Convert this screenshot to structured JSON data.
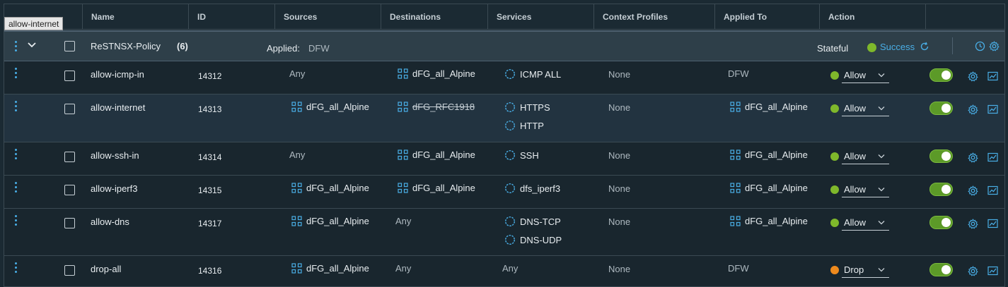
{
  "tooltip": "allow-internet",
  "columns": {
    "name": "Name",
    "id": "ID",
    "sources": "Sources",
    "destinations": "Destinations",
    "services": "Services",
    "context_profiles": "Context Profiles",
    "applied_to": "Applied To",
    "action": "Action"
  },
  "policy": {
    "name": "ReSTNSX-Policy",
    "count": "(6)",
    "applied_label": "Applied:",
    "applied_value": "DFW",
    "stateful": "Stateful",
    "status": "Success"
  },
  "rules": [
    {
      "name": "allow-icmp-in",
      "id": "14312",
      "sources": [
        {
          "text": "Any",
          "icon": "none"
        }
      ],
      "destinations": [
        {
          "text": "dFG_all_Alpine",
          "icon": "group-icon"
        }
      ],
      "services": [
        "ICMP ALL"
      ],
      "context": "None",
      "applied_to": [
        {
          "text": "DFW",
          "icon": "none"
        }
      ],
      "action": "Allow",
      "action_color": "#7fb82b"
    },
    {
      "name": "allow-internet",
      "id": "14313",
      "sources": [
        {
          "text": "dFG_all_Alpine",
          "icon": "group-icon"
        }
      ],
      "destinations": [
        {
          "text": "dFG_RFC1918",
          "icon": "group-icon",
          "negated": true
        }
      ],
      "services": [
        "HTTPS",
        "HTTP"
      ],
      "context": "None",
      "applied_to": [
        {
          "text": "dFG_all_Alpine",
          "icon": "group-icon"
        }
      ],
      "action": "Allow",
      "action_color": "#7fb82b"
    },
    {
      "name": "allow-ssh-in",
      "id": "14314",
      "sources": [
        {
          "text": "Any",
          "icon": "none"
        }
      ],
      "destinations": [
        {
          "text": "dFG_all_Alpine",
          "icon": "group-icon"
        }
      ],
      "services": [
        "SSH"
      ],
      "context": "None",
      "applied_to": [
        {
          "text": "dFG_all_Alpine",
          "icon": "group-icon"
        }
      ],
      "action": "Allow",
      "action_color": "#7fb82b"
    },
    {
      "name": "allow-iperf3",
      "id": "14315",
      "sources": [
        {
          "text": "dFG_all_Alpine",
          "icon": "group-icon"
        }
      ],
      "destinations": [
        {
          "text": "dFG_all_Alpine",
          "icon": "group-icon"
        }
      ],
      "services": [
        "dfs_iperf3"
      ],
      "context": "None",
      "applied_to": [
        {
          "text": "dFG_all_Alpine",
          "icon": "group-icon"
        }
      ],
      "action": "Allow",
      "action_color": "#7fb82b"
    },
    {
      "name": "allow-dns",
      "id": "14317",
      "sources": [
        {
          "text": "dFG_all_Alpine",
          "icon": "group-icon"
        }
      ],
      "destinations": [
        {
          "text": "Any",
          "icon": "none"
        }
      ],
      "services": [
        "DNS-TCP",
        "DNS-UDP"
      ],
      "context": "None",
      "applied_to": [
        {
          "text": "dFG_all_Alpine",
          "icon": "group-icon"
        }
      ],
      "action": "Allow",
      "action_color": "#7fb82b"
    },
    {
      "name": "drop-all",
      "id": "14316",
      "sources": [
        {
          "text": "dFG_all_Alpine",
          "icon": "group-icon"
        }
      ],
      "destinations": [
        {
          "text": "Any",
          "icon": "none"
        }
      ],
      "services": [
        "Any"
      ],
      "context": "None",
      "applied_to": [
        {
          "text": "DFW",
          "icon": "none"
        }
      ],
      "action": "Drop",
      "action_color": "#ee8a1d"
    }
  ],
  "colors": {
    "accent": "#49aee6",
    "success": "#7fb82b",
    "drop": "#ee8a1d",
    "toggle_on": "#5c9a28"
  }
}
